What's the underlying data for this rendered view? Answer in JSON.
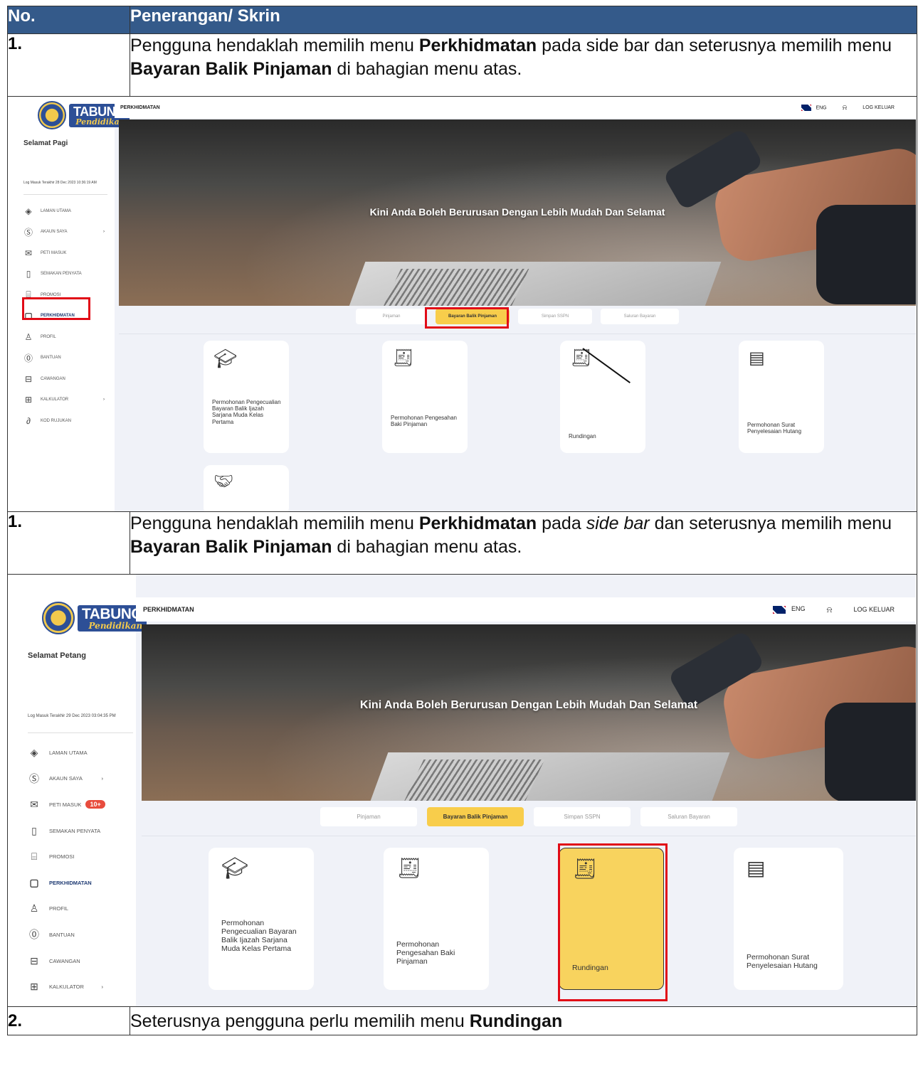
{
  "table": {
    "header_no": "No.",
    "header_desc": "Penerangan/ Skrin",
    "row1_num": "1.",
    "row1_desc_a": "Pengguna hendaklah memilih menu ",
    "row1_desc_b": "Perkhidmatan",
    "row1_desc_c": " pada side bar dan seterusnya memilih menu ",
    "row1_desc_d": "Bayaran Balik Pinjaman",
    "row1_desc_e": " di bahagian menu atas.",
    "row2_num": "1.",
    "row2_desc_a": "Pengguna hendaklah memilih menu ",
    "row2_desc_b": "Perkhidmatan",
    "row2_desc_c": " pada ",
    "row2_desc_i": "side bar",
    "row2_desc_d": " dan seterusnya memilih menu ",
    "row2_desc_e": "Bayaran Balik Pinjaman",
    "row2_desc_f": " di bahagian menu atas.",
    "row3_num": "2.",
    "row3_desc_a": "Seterusnya pengguna perlu memilih menu  ",
    "row3_desc_b": "Rundingan"
  },
  "app": {
    "logo_line1": "TABUNG",
    "logo_line2": "Pendidikan",
    "page_title": "PERKHIDMATAN",
    "lang": "ENG",
    "logout": "LOG KELUAR",
    "hero_caption": "Kini Anda Boleh Berurusan Dengan Lebih Mudah Dan Selamat",
    "nav": [
      "LAMAN UTAMA",
      "AKAUN SAYA",
      "PETI MASUK",
      "SEMAKAN PENYATA",
      "PROMOSI",
      "PERKHIDMATAN",
      "PROFIL",
      "BANTUAN",
      "CAWANGAN",
      "KALKULATOR",
      "KOD RUJUKAN"
    ],
    "tabs": [
      "Pinjaman",
      "Bayaran Balik Pinjaman",
      "Simpan SSPN",
      "Saluran Bayaran"
    ],
    "cards": [
      "Permohonan Pengecualian Bayaran Balik Ijazah Sarjana Muda Kelas Pertama",
      "Permohonan Pengesahan Baki Pinjaman",
      "Rundingan",
      "Permohonan Surat Penyelesaian Hutang"
    ],
    "icons": {
      "mortarboard": "mortarboard-icon",
      "receipt": "receipt-icon",
      "document_myr": "document-myr-icon",
      "handshake": "handshake-icon"
    }
  },
  "shot1": {
    "greeting": "Selamat Pagi",
    "last_login": "Log Masuk Terakhir 28 Dec 2023 10:36:19 AM"
  },
  "shot2": {
    "greeting": "Selamat Petang",
    "last_login": "Log Masuk Terakhir 29 Dec 2023 03:04:35 PM",
    "inbox_badge": "10+"
  },
  "colors": {
    "header_bg": "#345a8a",
    "highlight": "#e10b17",
    "tab_selected": "#f8cd4b",
    "brand": "#2d4f96"
  }
}
